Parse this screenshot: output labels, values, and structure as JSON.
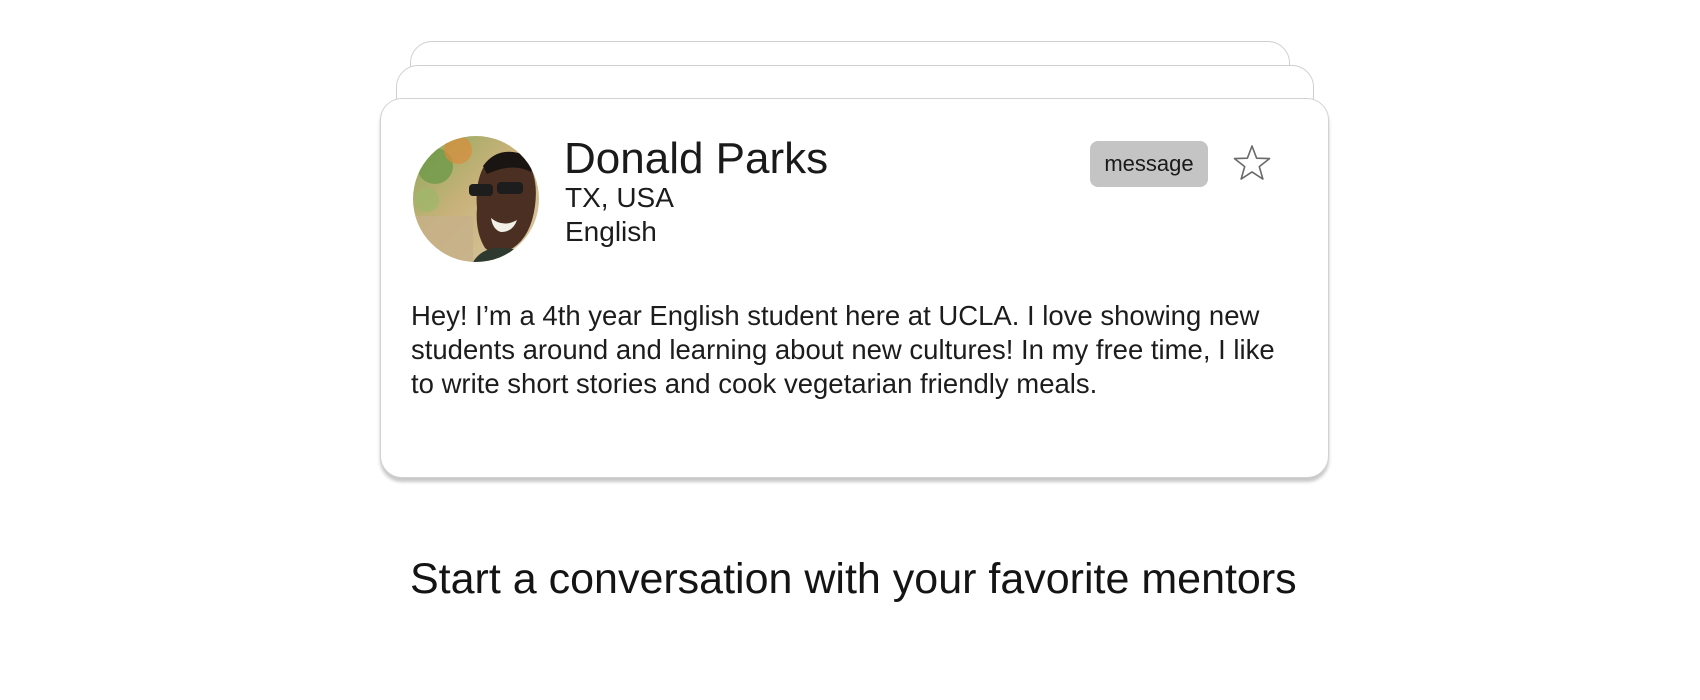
{
  "profile": {
    "name": "Donald Parks",
    "location": "TX, USA",
    "language": "English",
    "bio": "Hey! I’m a 4th year English student here at UCLA. I love showing new students around and learning about new cultures! In my free time, I like to write short stories and cook vegetarian friendly meals.",
    "avatar_icon": "profile-photo",
    "favorite_icon": "star-outline-icon"
  },
  "actions": {
    "message_label": "message"
  },
  "cta": {
    "heading": "Start a conversation with your favorite mentors"
  },
  "colors": {
    "button_bg": "#c4c4c4",
    "card_border": "#d2d2d2",
    "text": "#1c1c1c"
  }
}
